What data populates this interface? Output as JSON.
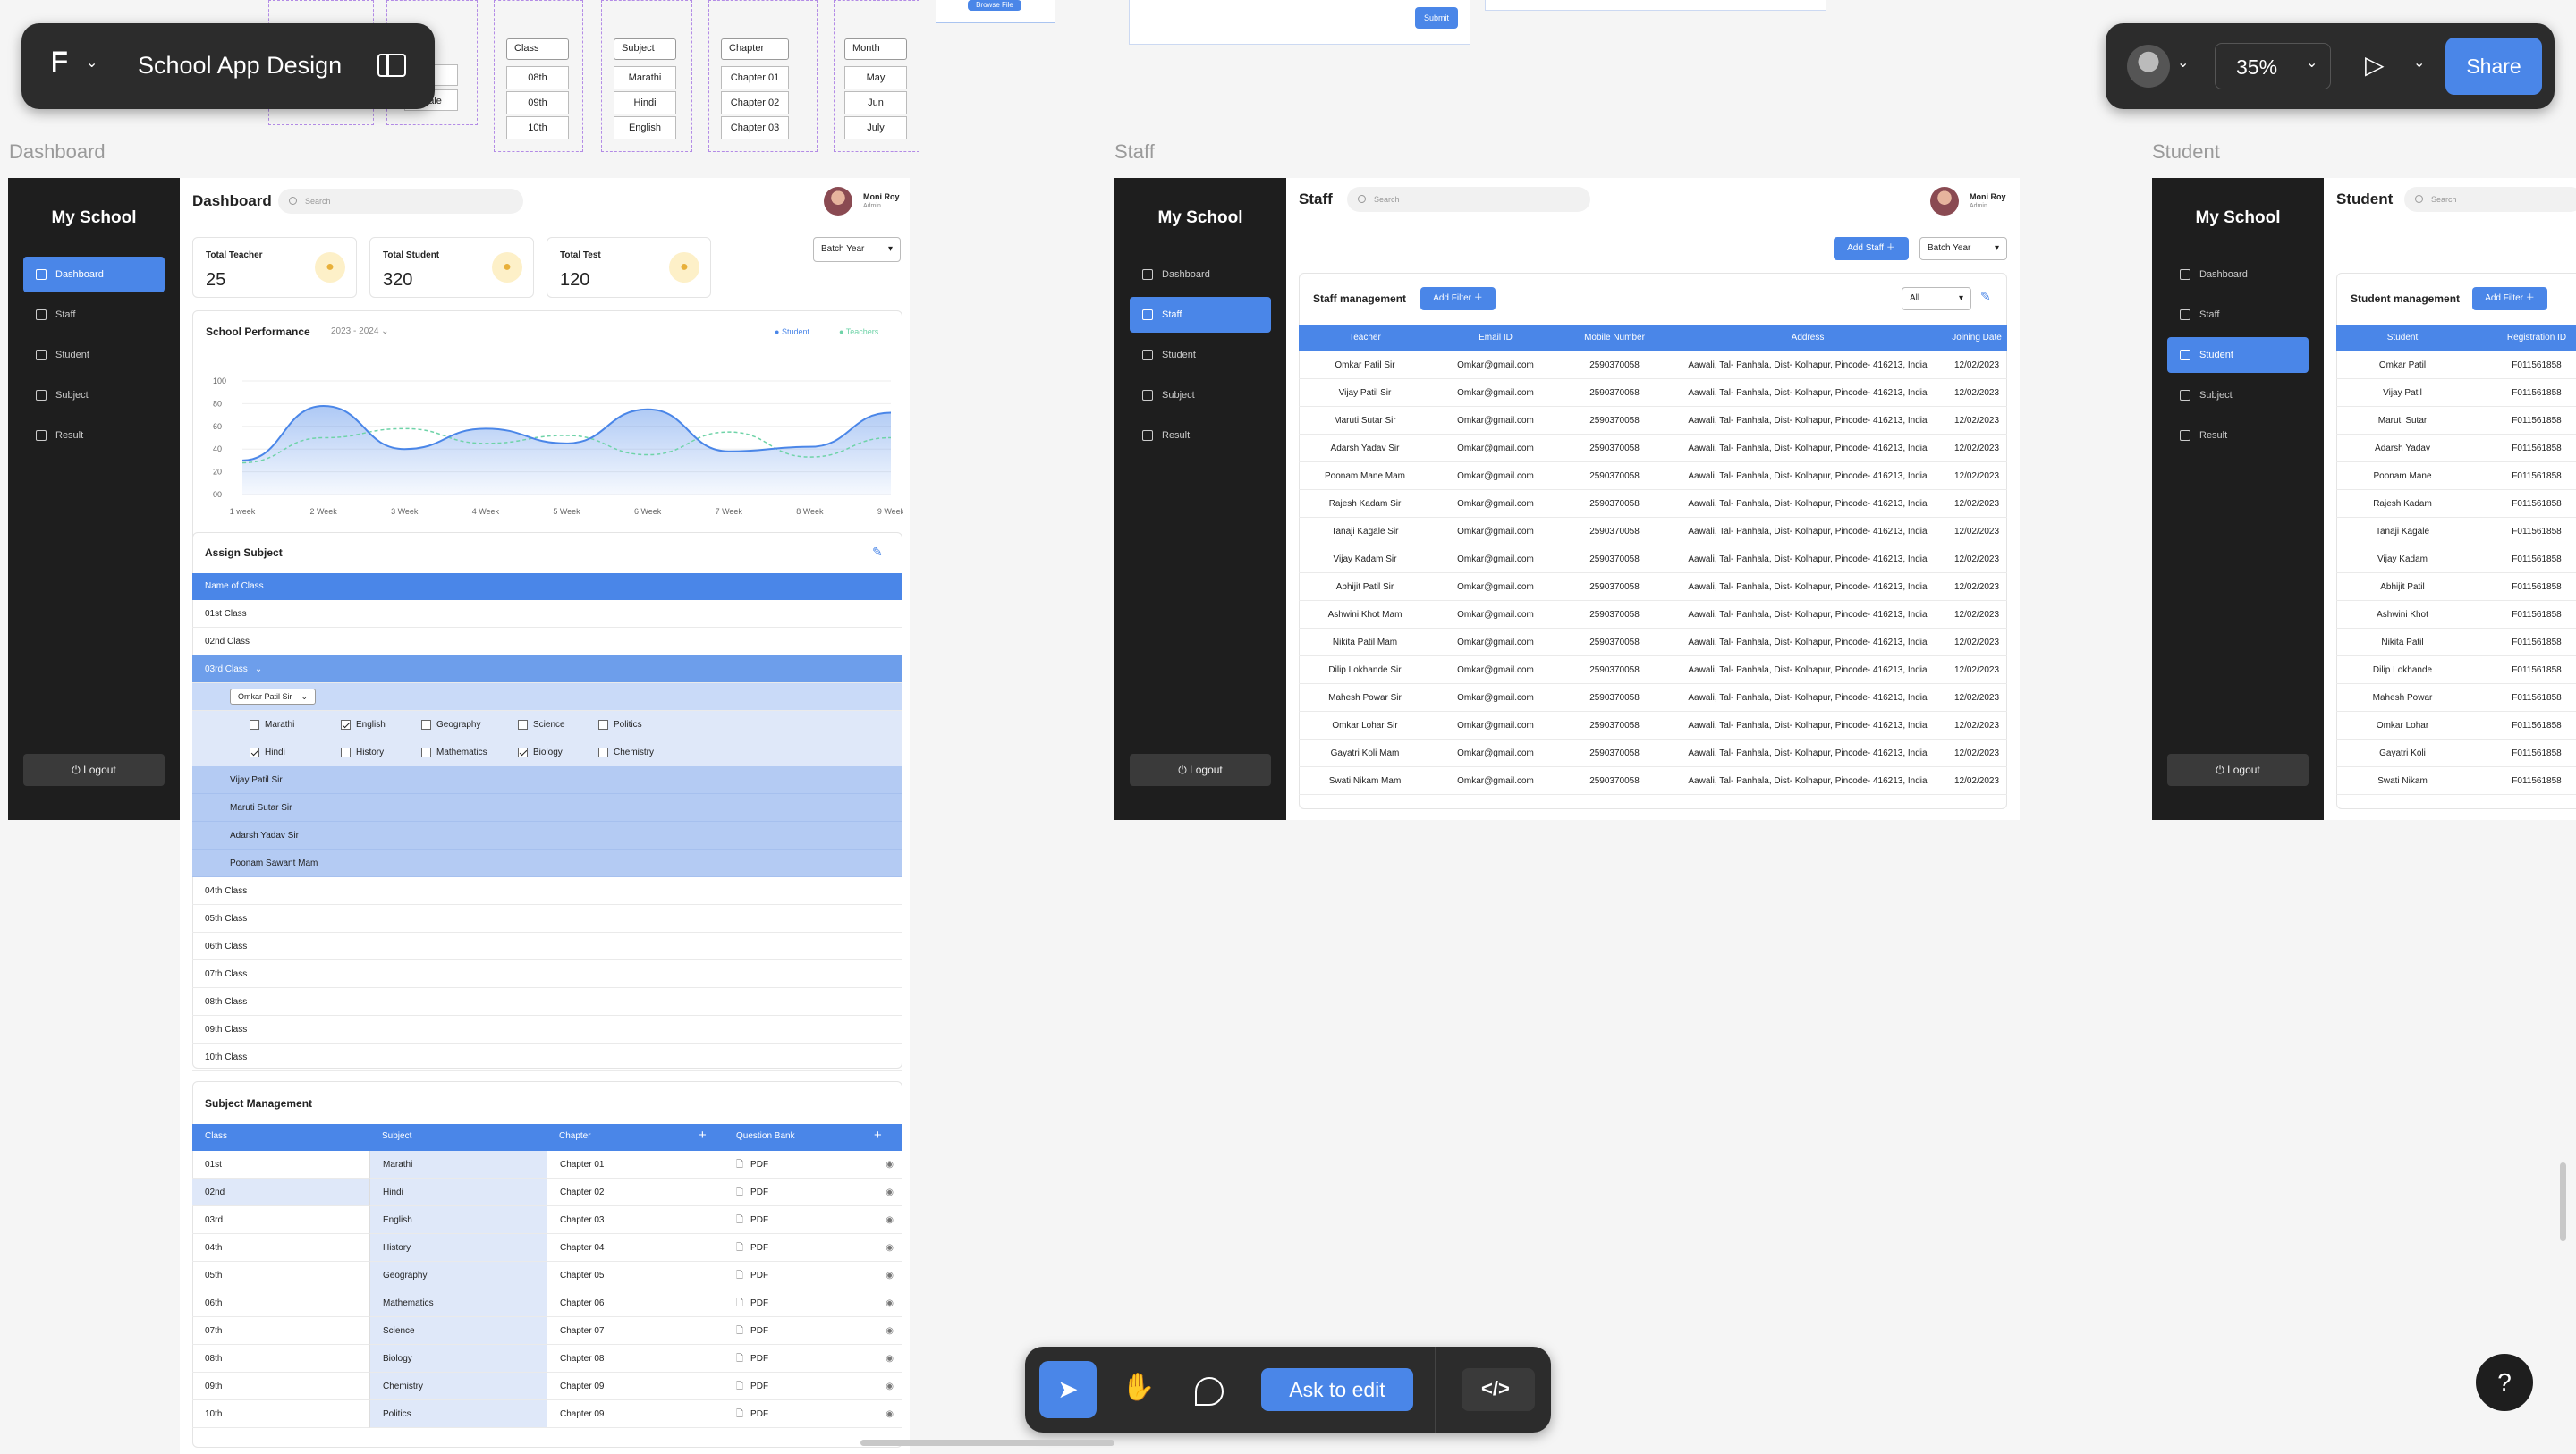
{
  "app": {
    "file_title": "School App Design",
    "zoom": "35%",
    "share_label": "Share",
    "ask_to_edit": "Ask to edit",
    "help": "?"
  },
  "frames": {
    "dashboard": "Dashboard",
    "staff": "Staff",
    "student": "Student"
  },
  "top_strip": {
    "gender": [
      "le",
      "male"
    ],
    "class": {
      "label": "Class",
      "items": [
        "08th",
        "09th",
        "10th"
      ]
    },
    "subject": {
      "label": "Subject",
      "items": [
        "Marathi",
        "Hindi",
        "English"
      ]
    },
    "chapter": {
      "label": "Chapter",
      "items": [
        "Chapter 01",
        "Chapter 02",
        "Chapter 03"
      ]
    },
    "month": {
      "label": "Month",
      "items": [
        "May",
        "Jun",
        "July"
      ]
    },
    "browse_file": "Browse File",
    "submit": "Submit"
  },
  "sidebar": {
    "logo": "My School",
    "items": [
      "Dashboard",
      "Staff",
      "Student",
      "Subject",
      "Result"
    ],
    "logout": "Logout"
  },
  "header": {
    "search_placeholder": "Search",
    "user_name": "Moni Roy",
    "user_role": "Admin"
  },
  "dashboard": {
    "title": "Dashboard",
    "batch_year": "Batch Year",
    "stats": [
      {
        "label": "Total Teacher",
        "value": "25"
      },
      {
        "label": "Total Student",
        "value": "320"
      },
      {
        "label": "Total Test",
        "value": "120"
      }
    ],
    "performance": {
      "title": "School Performance",
      "year": "2023 - 2024",
      "legend": [
        "Student",
        "Teachers"
      ]
    },
    "assign_subject": {
      "title": "Assign Subject",
      "header": "Name of Class",
      "classes_top": [
        "01st Class",
        "02nd Class"
      ],
      "open_class": "03rd Class",
      "selected_teacher": "Omkar Patil Sir",
      "subjects_row1": [
        {
          "name": "Marathi",
          "checked": false
        },
        {
          "name": "English",
          "checked": true
        },
        {
          "name": "Geography",
          "checked": false
        },
        {
          "name": "Science",
          "checked": false
        },
        {
          "name": "Politics",
          "checked": false
        }
      ],
      "subjects_row2": [
        {
          "name": "Hindi",
          "checked": true
        },
        {
          "name": "History",
          "checked": false
        },
        {
          "name": "Mathematics",
          "checked": false
        },
        {
          "name": "Biology",
          "checked": true
        },
        {
          "name": "Chemistry",
          "checked": false
        }
      ],
      "teachers": [
        "Vijay Patil Sir",
        "Maruti Sutar Sir",
        "Adarsh Yadav Sir",
        "Poonam Sawant Mam"
      ],
      "classes_bottom": [
        "04th Class",
        "05th Class",
        "06th Class",
        "07th Class",
        "08th Class",
        "09th Class",
        "10th Class"
      ]
    },
    "subject_management": {
      "title": "Subject Management",
      "headers": [
        "Class",
        "Subject",
        "Chapter",
        "Question Bank"
      ],
      "classes": [
        "01st",
        "02nd",
        "03rd",
        "04th",
        "05th",
        "06th",
        "07th",
        "08th",
        "09th",
        "10th"
      ],
      "subjects": [
        "Marathi",
        "Hindi",
        "English",
        "History",
        "Geography",
        "Mathematics",
        "Science",
        "Biology",
        "Chemistry",
        "Politics"
      ],
      "chapters": [
        "Chapter 01",
        "Chapter 02",
        "Chapter 03",
        "Chapter 04",
        "Chapter 05",
        "Chapter 06",
        "Chapter 07",
        "Chapter 08",
        "Chapter 09",
        "Chapter 09"
      ],
      "file_type": "PDF"
    }
  },
  "chart_data": {
    "type": "area",
    "title": "School Performance",
    "categories": [
      "1 week",
      "2 Week",
      "3 Week",
      "4 Week",
      "5 Week",
      "6 Week",
      "7 Week",
      "8 Week",
      "9 Week"
    ],
    "y_ticks": [
      "100",
      "80",
      "60",
      "40",
      "20",
      "00"
    ],
    "ylim": [
      0,
      100
    ],
    "series": [
      {
        "name": "Student",
        "values": [
          30,
          78,
          40,
          58,
          45,
          75,
          38,
          42,
          72
        ]
      },
      {
        "name": "Teachers",
        "values": [
          28,
          50,
          58,
          45,
          52,
          35,
          55,
          33,
          50
        ]
      }
    ],
    "colors": {
      "Student": "#4a86e8",
      "Teachers": "#6fd3a8"
    }
  },
  "staff": {
    "title": "Staff",
    "add_staff": "Add Staff",
    "batch_year": "Batch Year",
    "section_title": "Staff management",
    "add_filter": "Add Filter",
    "filter_value": "All",
    "headers": [
      "Teacher",
      "Email ID",
      "Mobile Number",
      "Address",
      "Joining Date"
    ],
    "names": [
      "Omkar Patil Sir",
      "Vijay Patil Sir",
      "Maruti Sutar Sir",
      "Adarsh Yadav Sir",
      "Poonam Mane Mam",
      "Rajesh Kadam Sir",
      "Tanaji Kagale Sir",
      "Vijay Kadam Sir",
      "Abhijit Patil Sir",
      "Ashwini Khot Mam",
      "Nikita Patil Mam",
      "Dilip Lokhande Sir",
      "Mahesh Powar Sir",
      "Omkar Lohar Sir",
      "Gayatri Koli Mam",
      "Swati Nikam Mam"
    ],
    "email": "Omkar@gmail.com",
    "mobile": "2590370058",
    "address": "Aawali, Tal- Panhala, Dist- Kolhapur, Pincode- 416213, India",
    "date": "12/02/2023"
  },
  "student": {
    "title": "Student",
    "section_title": "Student management",
    "add_filter": "Add Filter",
    "headers": [
      "Student",
      "Registration ID"
    ],
    "names": [
      "Omkar Patil",
      "Vijay Patil",
      "Maruti Sutar",
      "Adarsh Yadav",
      "Poonam Mane",
      "Rajesh Kadam",
      "Tanaji Kagale",
      "Vijay Kadam",
      "Abhijit Patil",
      "Ashwini Khot",
      "Nikita Patil",
      "Dilip Lokhande",
      "Mahesh Powar",
      "Omkar Lohar",
      "Gayatri Koli",
      "Swati Nikam"
    ],
    "reg_id": "F011561858"
  }
}
